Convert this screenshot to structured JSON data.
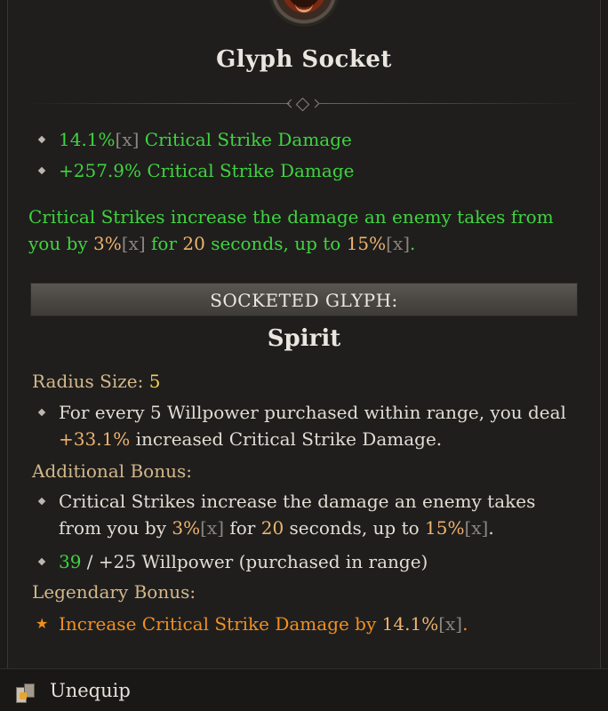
{
  "header": {
    "title": "Glyph Socket"
  },
  "stats": [
    {
      "value": "14.1%",
      "scale_tag": "[x]",
      "text": " Critical Strike Damage"
    },
    {
      "value": "+257.9%",
      "text": " Critical Strike Damage"
    }
  ],
  "effect": {
    "line1": "Critical Strikes increase the damage an enemy takes from",
    "line2_a": "you by ",
    "val1": "3%",
    "tag1": "[x]",
    "line2_b": " for ",
    "val2": "20",
    "line2_c": " seconds, up to ",
    "val3": "15%",
    "tag3": "[x]",
    "line2_d": "."
  },
  "socketed": {
    "header": "SOCKETED GLYPH:",
    "name": "Spirit"
  },
  "radius": {
    "label": "Radius Size: ",
    "value": "5"
  },
  "glyph_effect": {
    "line1": "For every 5 Willpower purchased within range, you deal",
    "value": "+33.1%",
    "line2": " increased Critical Strike Damage."
  },
  "additional": {
    "label": "Additional Bonus:",
    "line1": "Critical Strikes increase the damage an enemy takes",
    "l2_a": "from you by ",
    "val1": "3%",
    "tag1": "[x]",
    "l2_b": " for ",
    "val2": "20",
    "l2_c": " seconds, up to ",
    "val3": "15%",
    "tag3": "[x]",
    "l2_d": ".",
    "req_current": "39",
    "req_rest": " / +25 Willpower (purchased in range)"
  },
  "legendary": {
    "label": "Legendary Bonus:",
    "text": "Increase Critical Strike Damage by ",
    "value": "14.1%",
    "tag": "[x]",
    "end": "."
  },
  "footer": {
    "action_label": "Unequip",
    "icon": "glyph-scroll-icon"
  },
  "colors": {
    "stat_green": "#3fd43f",
    "value_orange": "#e69b49",
    "legendary_orange": "#f2901f",
    "label_tan": "#d4b88a",
    "scale_grey": "#8a857e"
  }
}
